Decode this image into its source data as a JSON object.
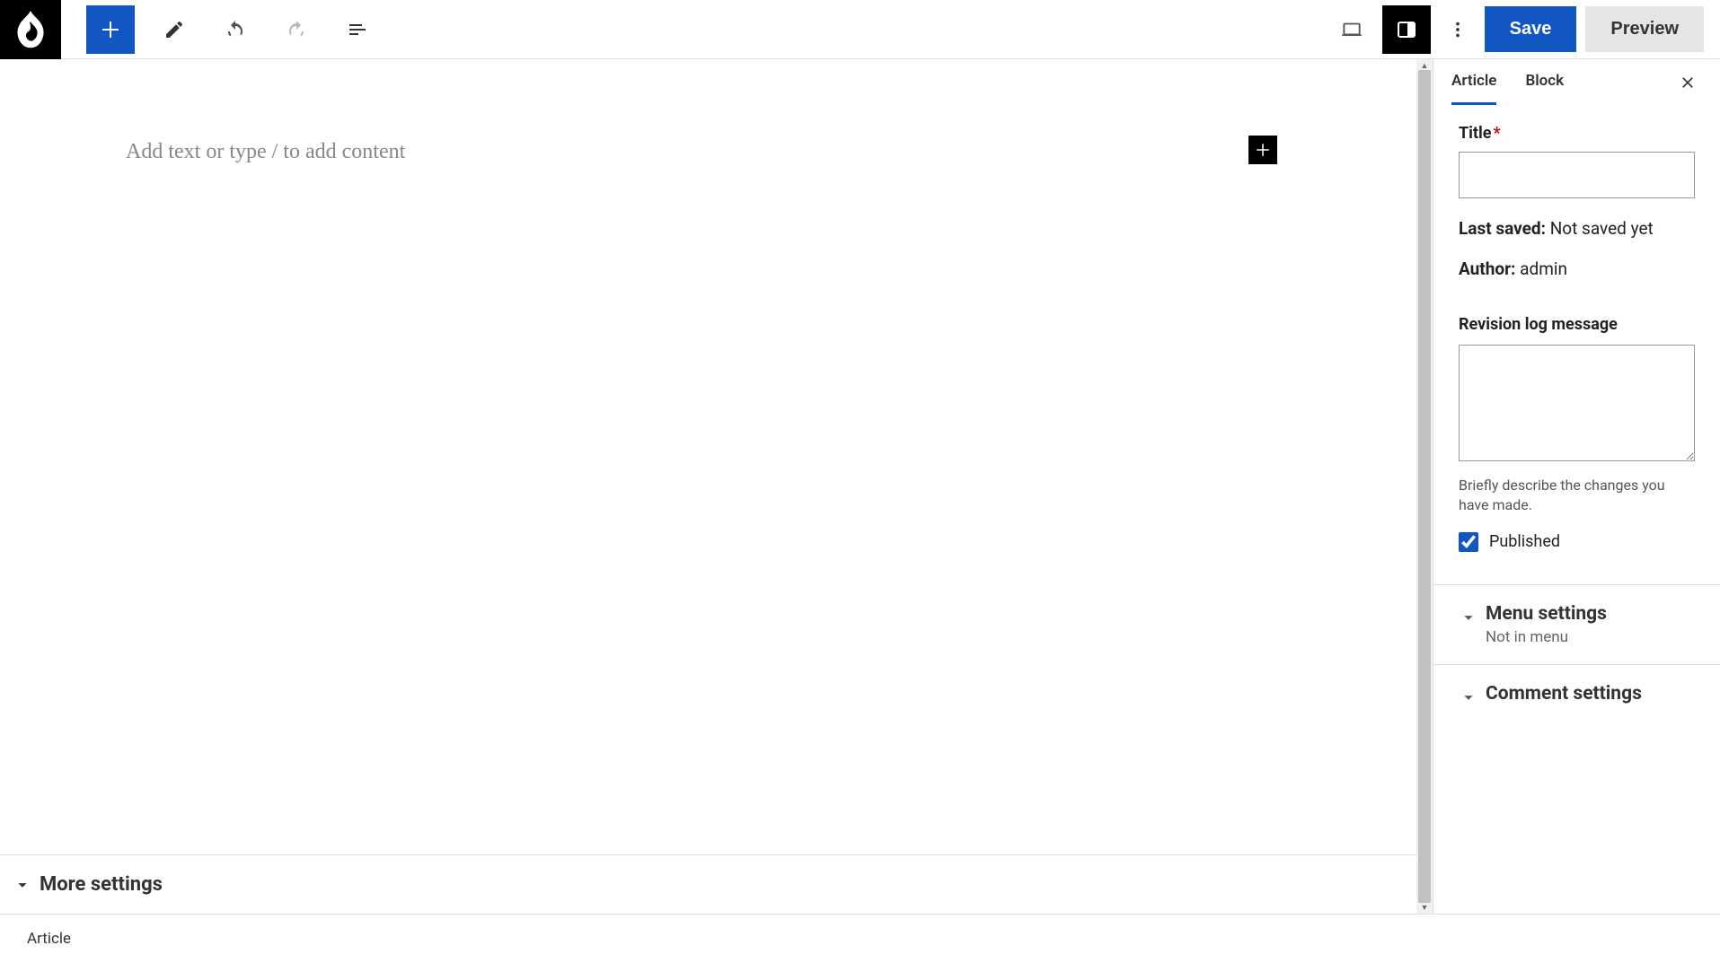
{
  "toolbar": {
    "save_label": "Save",
    "preview_label": "Preview"
  },
  "editor": {
    "placeholder": "Add text or type / to add content",
    "more_settings_label": "More settings"
  },
  "sidebar": {
    "tabs": {
      "article": "Article",
      "block": "Block"
    },
    "title_label": "Title",
    "title_value": "",
    "last_saved_label": "Last saved:",
    "last_saved_value": "Not saved yet",
    "author_label": "Author:",
    "author_value": "admin",
    "revision_label": "Revision log message",
    "revision_value": "",
    "revision_help": "Briefly describe the changes you have made.",
    "published_label": "Published",
    "published_checked": true,
    "menu_settings": {
      "title": "Menu settings",
      "sub": "Not in menu"
    },
    "comment_settings": {
      "title": "Comment settings"
    }
  },
  "footer": {
    "breadcrumb": "Article"
  }
}
